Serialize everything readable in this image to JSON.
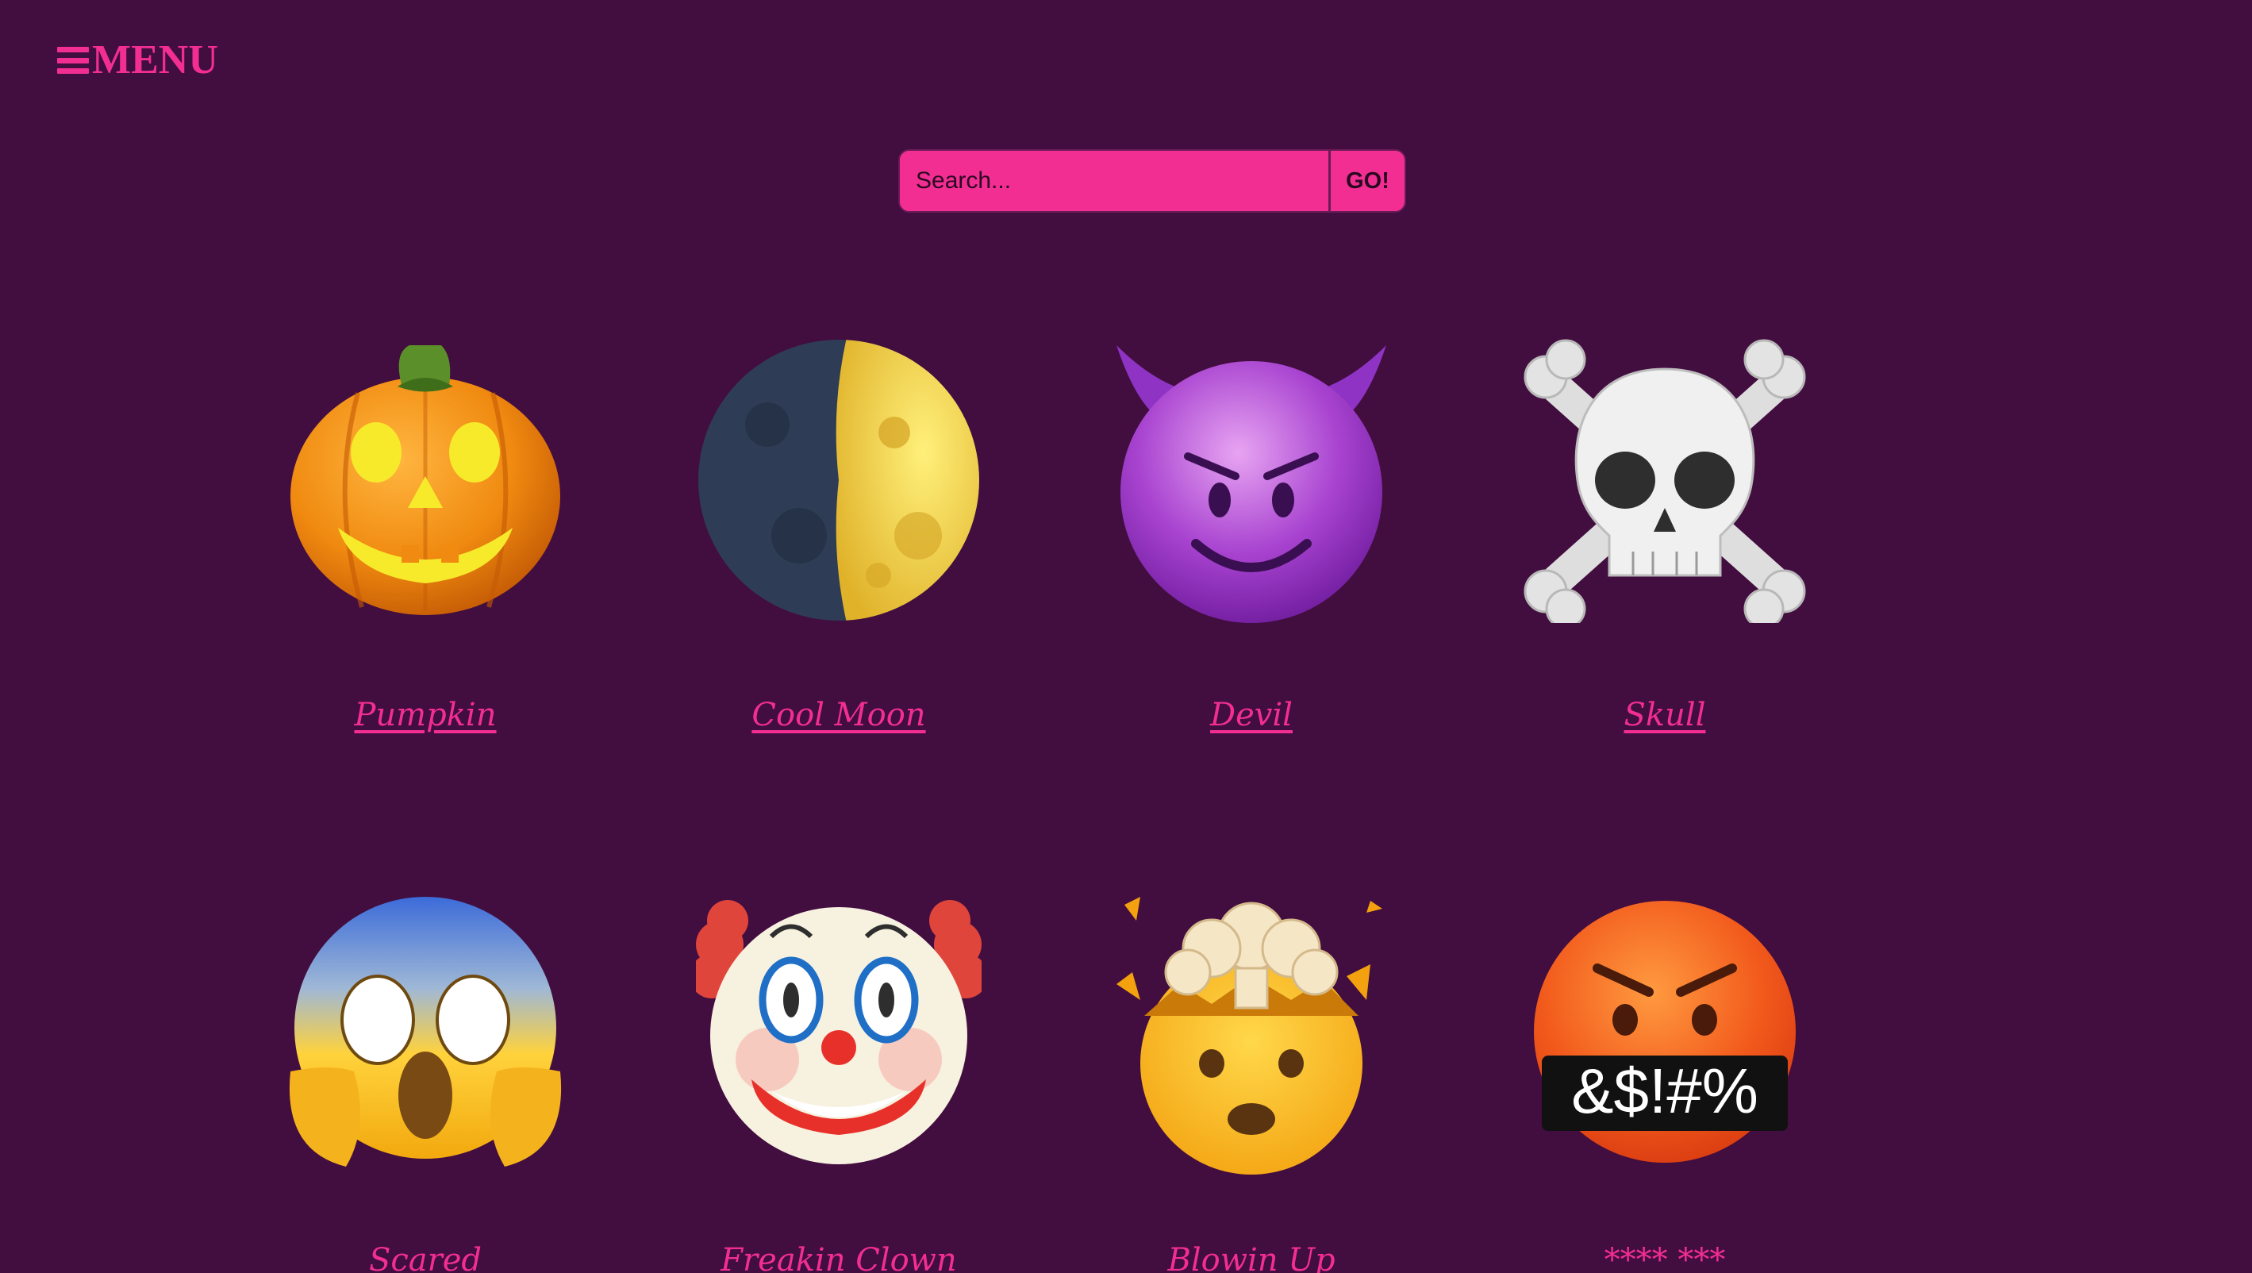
{
  "menu": {
    "label": "MENU"
  },
  "search": {
    "placeholder": "Search...",
    "go_label": "GO!"
  },
  "emojis": [
    {
      "label": "Pumpkin",
      "icon": "jack-o-lantern-icon"
    },
    {
      "label": "Cool Moon",
      "icon": "moon-icon"
    },
    {
      "label": "Devil",
      "icon": "devil-icon"
    },
    {
      "label": "Skull",
      "icon": "skull-crossbones-icon"
    },
    {
      "label": "Scared",
      "icon": "scream-face-icon"
    },
    {
      "label": "Freakin Clown",
      "icon": "clown-face-icon"
    },
    {
      "label": "Blowin Up",
      "icon": "exploding-head-icon"
    },
    {
      "label": "**** ***",
      "icon": "cursing-face-icon"
    }
  ],
  "colors": {
    "background": "#420d3f",
    "accent": "#f22e92"
  }
}
